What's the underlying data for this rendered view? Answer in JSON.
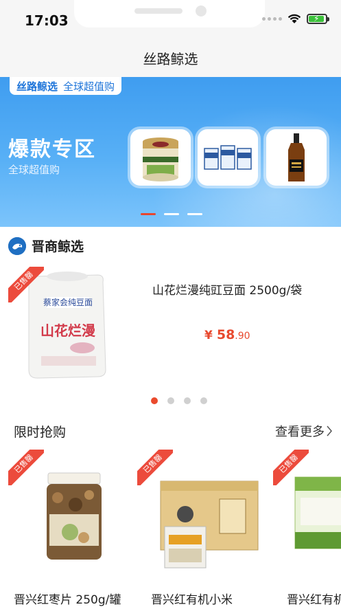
{
  "status_bar": {
    "time": "17:03"
  },
  "nav": {
    "title": "丝路鲸选"
  },
  "banner": {
    "brand": "丝路鲸选",
    "slogan": "全球超值购",
    "title": "爆款专区",
    "subtitle": "全球超值购",
    "products": [
      "sheep-milk-powder-can",
      "milk-cartons",
      "whisky-bottle"
    ],
    "active_dot": 0
  },
  "section": {
    "title": "晋商鲸选"
  },
  "featured": {
    "badge": "已售罄",
    "name": "山花烂漫纯豇豆面 2500g/袋",
    "price_symbol": "¥",
    "price_int": "58",
    "price_dec": ".90",
    "bag_text": "蔡家会纯豆面",
    "bag_brand": "山花烂漫"
  },
  "pager": {
    "count": 4,
    "active": 0
  },
  "flash_sale": {
    "title": "限时抢购",
    "more_label": "查看更多",
    "items": [
      {
        "badge": "已售罄",
        "name": "晋兴红枣片 250g/罐"
      },
      {
        "badge": "已售罄",
        "name": "晋兴红有机小米"
      },
      {
        "badge": "已售罄",
        "name": "晋兴红有机"
      }
    ]
  },
  "colors": {
    "accent": "#ea4a2d",
    "banner_blue": "#4aa6f4",
    "price": "#e8492e"
  }
}
